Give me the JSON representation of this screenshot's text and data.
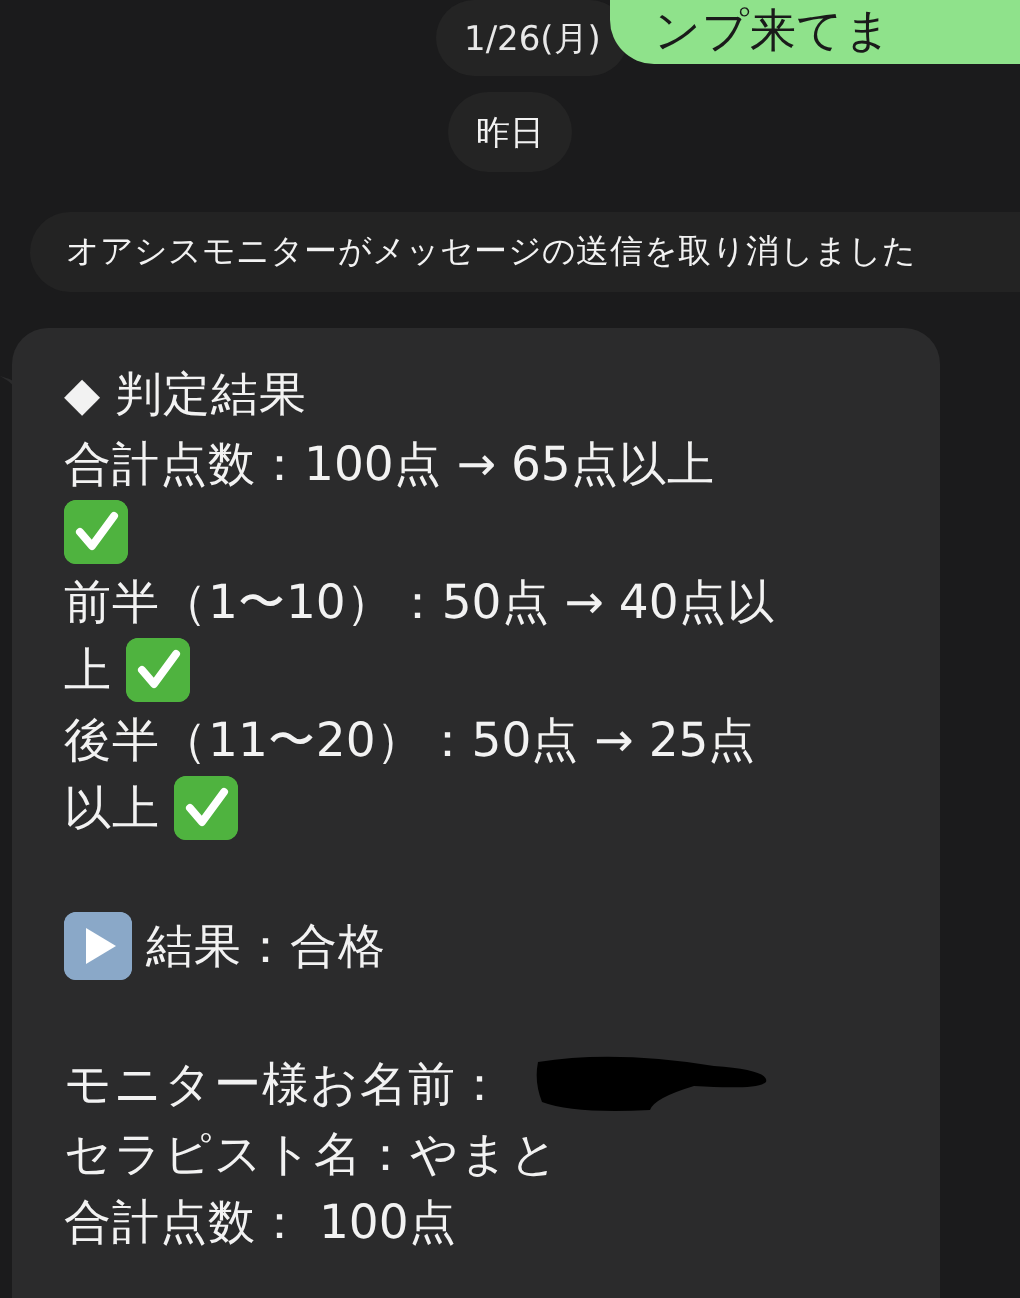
{
  "top": {
    "date_chip": "1/26(月)",
    "sent_message": "ンプ来てま"
  },
  "day_chip": "昨日",
  "notice": "オアシスモニターがメッセージの送信を取り消しました",
  "message": {
    "lines": [
      {
        "kind": "text",
        "text": "◆ 判定結果"
      },
      {
        "kind": "text",
        "text": "合計点数：100点 → 65点以上"
      },
      {
        "kind": "check"
      },
      {
        "kind": "text",
        "text": "前半（1〜10）：50点 → 40点以"
      },
      {
        "kind": "text_check",
        "text": "上"
      },
      {
        "kind": "text",
        "text": "後半（11〜20）：50点 → 25点"
      },
      {
        "kind": "text_check",
        "text": "以上"
      },
      {
        "kind": "blank"
      },
      {
        "kind": "play_text",
        "text": "結果：合格"
      },
      {
        "kind": "blank"
      },
      {
        "kind": "redacted_text",
        "text": "モニター様お名前："
      },
      {
        "kind": "text",
        "text": "セラピスト名：やまと"
      },
      {
        "kind": "text",
        "text": "合計点数： 100点"
      }
    ]
  }
}
